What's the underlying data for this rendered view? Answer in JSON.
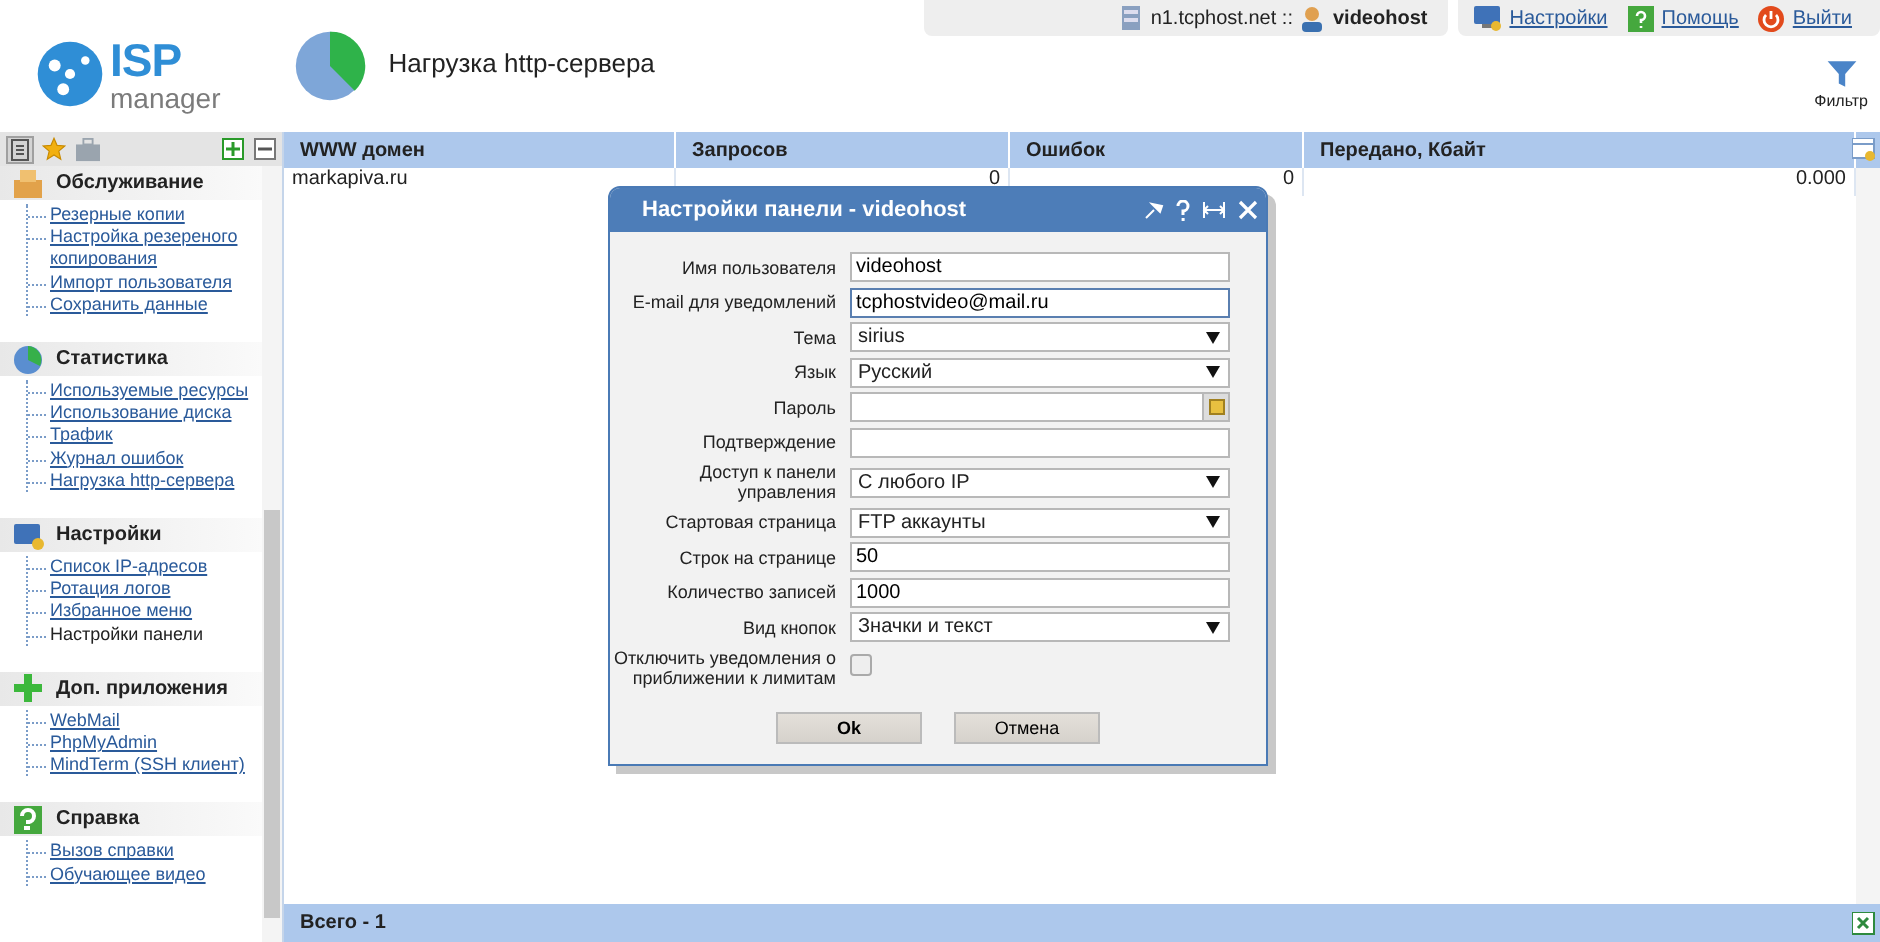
{
  "top_bar": {
    "server": "n1.tcphost.net ::",
    "user": "videohost",
    "links": [
      {
        "label": "Настройки",
        "kind": "settings"
      },
      {
        "label": "Помощь",
        "kind": "help"
      },
      {
        "label": "Выйти",
        "kind": "logout"
      }
    ]
  },
  "logo": {
    "big": "ISP",
    "small": "manager"
  },
  "page_title": "Нагрузка http-сервера",
  "toolbar": {
    "filter": "Фильтр"
  },
  "sidebar": {
    "tabs": [
      {
        "kind": "tree",
        "selected": true
      },
      {
        "kind": "star",
        "selected": false
      },
      {
        "kind": "case",
        "selected": false
      }
    ],
    "sections": [
      {
        "title": "Обслуживание",
        "kind": "box",
        "items": [
          {
            "label": "Резерные копии",
            "selected": false
          },
          {
            "label": "Настройка резереного копирования",
            "selected": false
          },
          {
            "label": "Импорт пользователя",
            "selected": false
          },
          {
            "label": "Сохранить данные",
            "selected": false
          }
        ]
      },
      {
        "title": "Статистика",
        "kind": "stats",
        "items": [
          {
            "label": "Используемые ресурсы",
            "selected": false
          },
          {
            "label": "Использование диска",
            "selected": false
          },
          {
            "label": "Трафик",
            "selected": false
          },
          {
            "label": "Журнал ошибок",
            "selected": false
          },
          {
            "label": "Нагрузка http-сервера",
            "selected": false
          }
        ]
      },
      {
        "title": "Настройки",
        "kind": "monitor",
        "items": [
          {
            "label": "Список IP-адресов",
            "selected": false
          },
          {
            "label": "Ротация логов",
            "selected": false
          },
          {
            "label": "Избранное меню",
            "selected": false
          },
          {
            "label": "Настройки панели",
            "selected": true
          }
        ]
      },
      {
        "title": "Доп. приложения",
        "kind": "plus",
        "items": [
          {
            "label": "WebMail",
            "selected": false
          },
          {
            "label": "PhpMyAdmin",
            "selected": false
          },
          {
            "label": "MindTerm (SSH клиент)",
            "selected": false
          }
        ]
      },
      {
        "title": "Справка",
        "kind": "help",
        "items": [
          {
            "label": "Вызов справки",
            "selected": false
          },
          {
            "label": "Обучающее видео",
            "selected": false
          }
        ]
      }
    ]
  },
  "table": {
    "columns": [
      "WWW домен",
      "Запросов",
      "Ошибок",
      "Передано, Кбайт"
    ],
    "rows": [
      [
        "markapiva.ru",
        "0",
        "0",
        "0.000"
      ]
    ],
    "footer": "Всего - 1"
  },
  "dialog": {
    "title": "Настройки панели - videohost",
    "fields": [
      {
        "label": "Имя пользователя",
        "kind": "text",
        "value": "videohost",
        "focused": false
      },
      {
        "label": "E-mail для уведомлений",
        "kind": "text",
        "value": "tcphostvideo@mail.ru",
        "focused": true
      },
      {
        "label": "Тема",
        "kind": "select",
        "value": "sirius",
        "focused": false
      },
      {
        "label": "Язык",
        "kind": "select",
        "value": "Русский",
        "focused": false
      },
      {
        "label": "Пароль",
        "kind": "password",
        "focused": false
      },
      {
        "label": "Подтверждение",
        "kind": "text",
        "focused": false
      },
      {
        "label": "Доступ к панели управления",
        "kind": "select",
        "value": "С любого IP",
        "focused": false
      },
      {
        "label": "Стартовая страница",
        "kind": "select",
        "value": "FTP аккаунты",
        "focused": false
      },
      {
        "label": "Строк на странице",
        "kind": "text",
        "value": "50",
        "focused": false
      },
      {
        "label": "Количество записей",
        "kind": "text",
        "value": "1000",
        "focused": false
      },
      {
        "label": "Вид кнопок",
        "kind": "select",
        "value": "Значки и текст",
        "focused": false
      },
      {
        "label": "Отключить уведомления о приближении к лимитам",
        "kind": "checkbox",
        "checked": false,
        "focused": false
      }
    ],
    "buttons": [
      {
        "label": "Ok",
        "kind": "primary"
      },
      {
        "label": "Отмена",
        "kind": "secondary"
      }
    ]
  }
}
